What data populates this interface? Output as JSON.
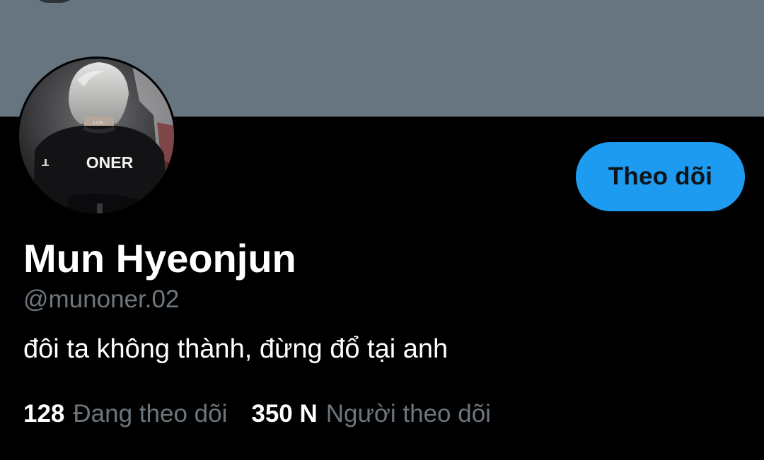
{
  "profile": {
    "display_name": "Mun Hyeonjun",
    "handle": "@munoner.02",
    "bio": "đôi ta không thành, đừng đổ tại anh",
    "avatar_jersey_text": "ONER",
    "avatar_collar_text": "LCK"
  },
  "actions": {
    "follow_label": "Theo dõi"
  },
  "stats": {
    "following_count": "128",
    "following_label": "Đang theo dõi",
    "followers_count": "350 N",
    "followers_label": "Người theo dõi"
  },
  "colors": {
    "banner": "#66757f",
    "background": "#000000",
    "accent": "#1d9bf0",
    "secondary_text": "#6e767d",
    "primary_text": "#ffffff"
  }
}
